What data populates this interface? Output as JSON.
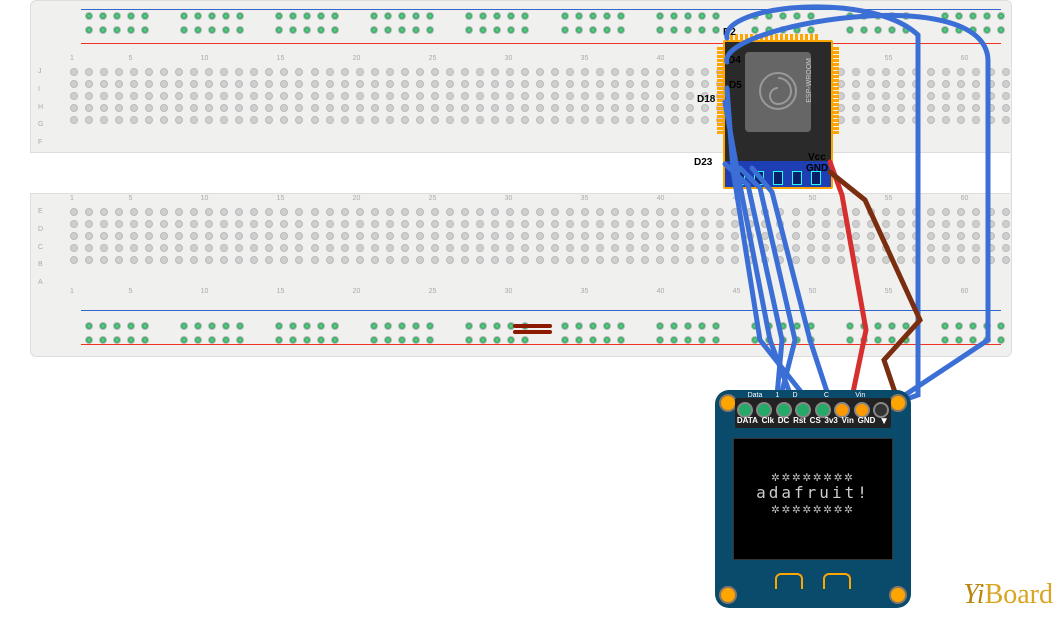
{
  "domain": "Diagram",
  "esp32": {
    "module_label": "ESP-WROOM",
    "pin_labels": [
      "D2",
      "D4",
      "D5",
      "D18",
      "D23",
      "Vcc",
      "GND"
    ]
  },
  "oled": {
    "pin_labels": [
      "DATA",
      "Clk",
      "DC",
      "Rst",
      "CS",
      "3v3",
      "Vin",
      "GND"
    ],
    "display_line": "adafruit!",
    "pin_header_top": [
      "Data",
      "1",
      "D",
      "C",
      "Vin"
    ]
  },
  "wiring": {
    "connections": [
      {
        "from": "ESP32 D2",
        "to": "OLED (top wrap)",
        "color": "blue"
      },
      {
        "from": "ESP32 D4",
        "to": "OLED (top wrap)",
        "color": "blue"
      },
      {
        "from": "ESP32 D5",
        "to": "OLED CS",
        "color": "blue"
      },
      {
        "from": "ESP32 D18",
        "to": "OLED Clk",
        "color": "blue"
      },
      {
        "from": "ESP32 D23",
        "to": "OLED DATA",
        "color": "blue"
      },
      {
        "from": "ESP32 Vcc",
        "to": "OLED Vin / 3v3",
        "color": "red"
      },
      {
        "from": "ESP32 GND",
        "to": "OLED GND",
        "color": "brown"
      }
    ],
    "colors": {
      "signal": "#3b6fd6",
      "power": "#d62f2f",
      "ground": "#7a2e0f"
    }
  },
  "breadboard": {
    "type": "full-size solderless breadboard",
    "row_letters_top": [
      "J",
      "I",
      "H",
      "G",
      "F"
    ],
    "row_letters_bot": [
      "E",
      "D",
      "C",
      "B",
      "A"
    ],
    "column_count": 63
  },
  "watermark": "YiBoard"
}
